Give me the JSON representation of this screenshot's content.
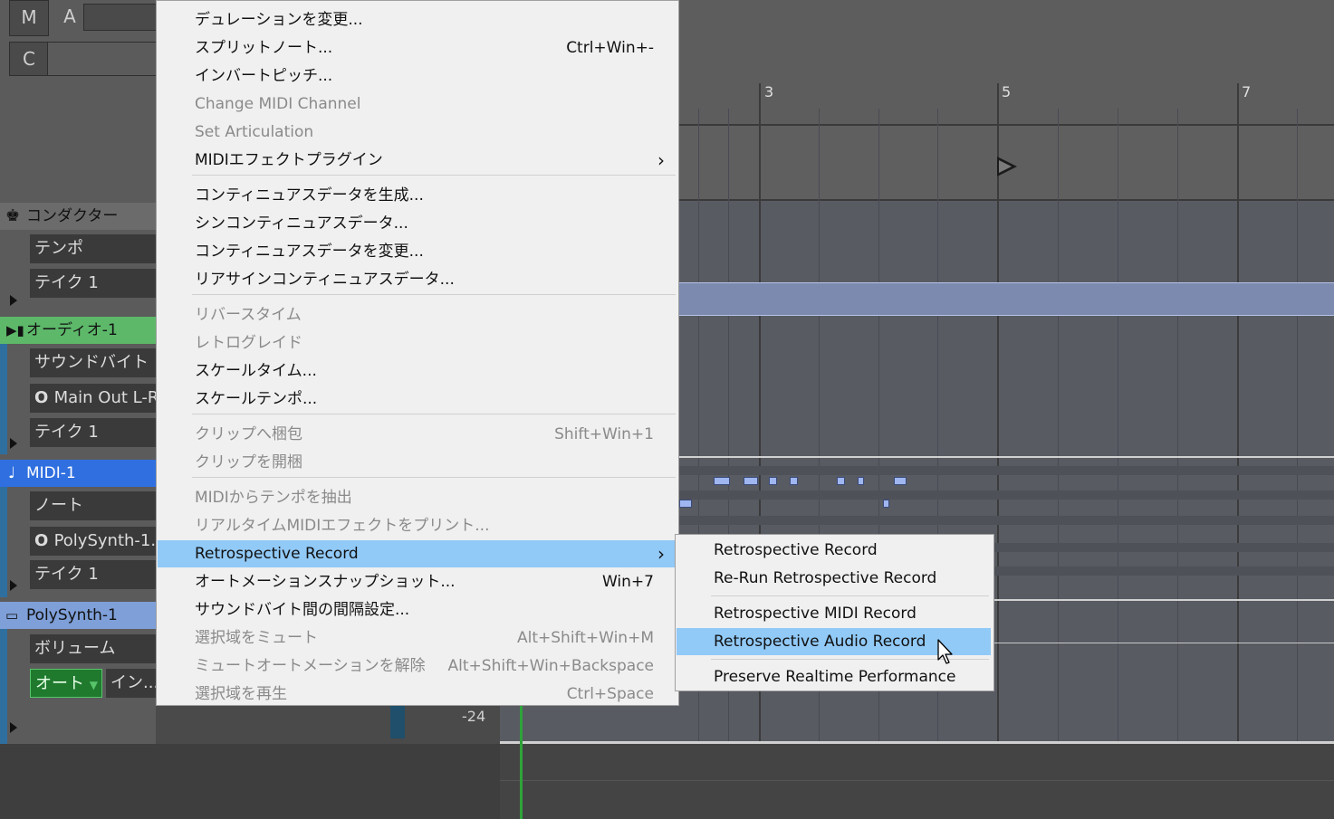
{
  "top_buttons": {
    "m": "M",
    "a": "A",
    "c": "C"
  },
  "tracks": {
    "conductor": {
      "name": "コンダクター",
      "fields": [
        "テンポ",
        "テイク 1"
      ]
    },
    "audio": {
      "name": "オーディオ-1",
      "fields": [
        "サウンドバイト",
        "Main Out L-R",
        "テイク 1"
      ],
      "color": "#5db86a"
    },
    "midi": {
      "name": "MIDI-1",
      "fields": [
        "ノート",
        "PolySynth-1...",
        "テイク 1"
      ],
      "color": "#2f6fe0"
    },
    "synth": {
      "name": "PolySynth-1",
      "fields": [
        "ボリューム"
      ],
      "auto_label": "オート",
      "in_label": "イン...",
      "color": "#7e9fd8"
    }
  },
  "ruler": {
    "marks": [
      "3",
      "5",
      "7"
    ]
  },
  "meter_value": "-24",
  "context_menu": {
    "groups": [
      [
        {
          "label": "デュレーションを変更...",
          "shortcut": "",
          "disabled": false
        },
        {
          "label": "スプリットノート...",
          "shortcut": "Ctrl+Win+-",
          "disabled": false
        },
        {
          "label": "インバートピッチ...",
          "shortcut": "",
          "disabled": false
        },
        {
          "label": "Change MIDI Channel",
          "shortcut": "",
          "disabled": true
        },
        {
          "label": "Set Articulation",
          "shortcut": "",
          "disabled": true
        },
        {
          "label": "MIDIエフェクトプラグイン",
          "shortcut": "",
          "disabled": false,
          "submenu": true
        }
      ],
      [
        {
          "label": "コンティニュアスデータを生成...",
          "shortcut": "",
          "disabled": false
        },
        {
          "label": "シンコンティニュアスデータ...",
          "shortcut": "",
          "disabled": false
        },
        {
          "label": "コンティニュアスデータを変更...",
          "shortcut": "",
          "disabled": false
        },
        {
          "label": "リアサインコンティニュアスデータ...",
          "shortcut": "",
          "disabled": false
        }
      ],
      [
        {
          "label": "リバースタイム",
          "shortcut": "",
          "disabled": true
        },
        {
          "label": "レトログレイド",
          "shortcut": "",
          "disabled": true
        },
        {
          "label": "スケールタイム...",
          "shortcut": "",
          "disabled": false
        },
        {
          "label": "スケールテンポ...",
          "shortcut": "",
          "disabled": false
        }
      ],
      [
        {
          "label": "クリップへ梱包",
          "shortcut": "Shift+Win+1",
          "disabled": true
        },
        {
          "label": "クリップを開梱",
          "shortcut": "",
          "disabled": true
        }
      ],
      [
        {
          "label": "MIDIからテンポを抽出",
          "shortcut": "",
          "disabled": true
        },
        {
          "label": "リアルタイムMIDIエフェクトをプリント...",
          "shortcut": "",
          "disabled": true
        },
        {
          "label": "Retrospective Record",
          "shortcut": "",
          "disabled": false,
          "submenu": true,
          "highlighted": true
        },
        {
          "label": "オートメーションスナップショット...",
          "shortcut": "Win+7",
          "disabled": false
        },
        {
          "label": "サウンドバイト間の間隔設定...",
          "shortcut": "",
          "disabled": false
        },
        {
          "label": "選択域をミュート",
          "shortcut": "Alt+Shift+Win+M",
          "disabled": true
        },
        {
          "label": "ミュートオートメーションを解除",
          "shortcut": "Alt+Shift+Win+Backspace",
          "disabled": true
        },
        {
          "label": "選択域を再生",
          "shortcut": "Ctrl+Space",
          "disabled": true
        }
      ]
    ]
  },
  "submenu": {
    "items": [
      {
        "label": "Retrospective Record"
      },
      {
        "label": "Re-Run Retrospective Record"
      },
      {
        "label": "Retrospective MIDI Record",
        "sep_before": true
      },
      {
        "label": "Retrospective Audio Record",
        "highlighted": true
      },
      {
        "label": "Preserve Realtime Performance",
        "sep_before": true
      }
    ]
  }
}
